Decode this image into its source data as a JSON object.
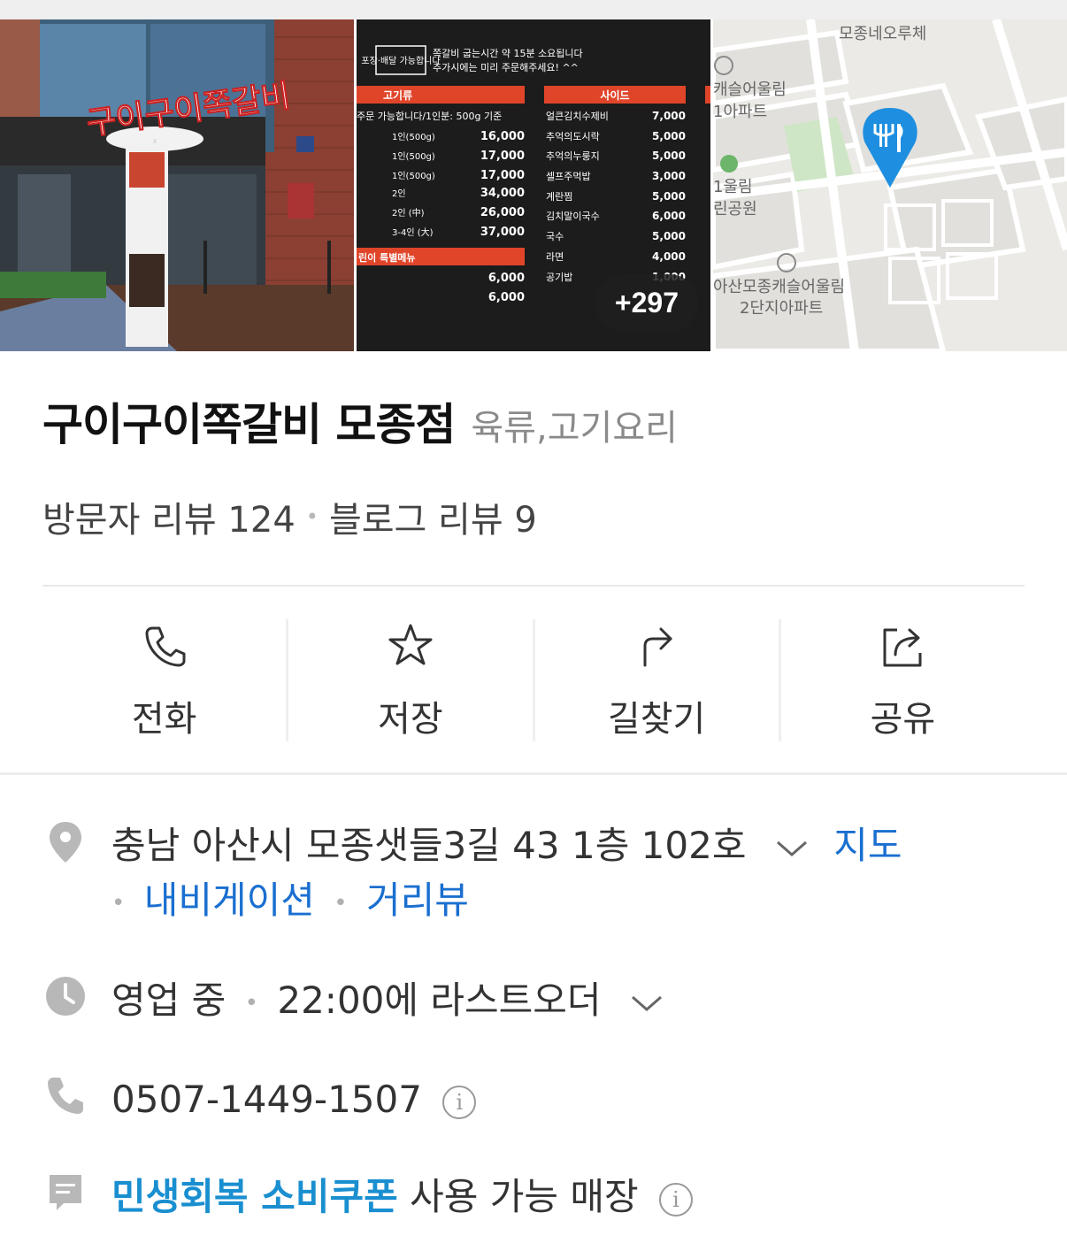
{
  "photos": {
    "more_count": "+297",
    "storefront": {
      "sign_text": "구이구이쪽갈비"
    },
    "menu": {
      "notice_badge": "포장·배달 가능합니다",
      "notice_line1": "쪽갈비 굽는시간 약 15분 소요됩니다",
      "notice_line2": "추가시에는 미리 주문해주세요! ^^",
      "meat_header": "고기류",
      "meat_note": "주문 가능합니다/1인분: 500g 기준",
      "meat_items": [
        {
          "name": "1인(500g)",
          "price": "16,000"
        },
        {
          "name": "1인(500g)",
          "price": "17,000"
        },
        {
          "name": "1인(500g)",
          "price": "17,000"
        },
        {
          "name": "2인",
          "price": "34,000"
        },
        {
          "name": "2인 (中)",
          "price": "26,000"
        },
        {
          "name": "3-4인 (大)",
          "price": "37,000"
        }
      ],
      "special_header": "린이 특별메뉴",
      "special_prices": [
        "6,000",
        "6,000"
      ],
      "side_header": "사이드",
      "side_items": [
        {
          "name": "얼큰김치수제비",
          "price": "7,000"
        },
        {
          "name": "추억의도시락",
          "price": "5,000"
        },
        {
          "name": "추억의누룽지",
          "price": "5,000"
        },
        {
          "name": "셀프주먹밥",
          "price": "3,000"
        },
        {
          "name": "계란찜",
          "price": "5,000"
        },
        {
          "name": "김치말이국수",
          "price": "6,000"
        },
        {
          "name": "국수",
          "price": "5,000"
        },
        {
          "name": "라면",
          "price": "4,000"
        },
        {
          "name": "공기밥",
          "price": "1,000"
        }
      ]
    },
    "map": {
      "label_top": "모종네오루체",
      "label_apt1_line1": "캐슬어울림",
      "label_apt1_line2": "1아파트",
      "label_park_line1": "1울림",
      "label_park_line2": "린공원",
      "label_apt2_line1": "아산모종캐슬어울림",
      "label_apt2_line2": "2단지아파트"
    }
  },
  "place": {
    "name": "구이구이쪽갈비 모종점",
    "category": "육류,고기요리",
    "visitor_reviews": "방문자 리뷰 124",
    "blog_reviews": "블로그 리뷰 9"
  },
  "actions": [
    {
      "label": "전화",
      "icon": "phone-icon"
    },
    {
      "label": "저장",
      "icon": "star-icon"
    },
    {
      "label": "길찾기",
      "icon": "directions-icon"
    },
    {
      "label": "공유",
      "icon": "share-icon"
    }
  ],
  "info": {
    "address": "충남 아산시 모종샛들3길 43 1층 102호",
    "map_link": "지도",
    "navigation_link": "내비게이션",
    "streetview_link": "거리뷰",
    "hours_status": "영업 중",
    "hours_detail": "22:00에 라스트오더",
    "phone": "0507-1449-1507",
    "coupon_highlight": "민생회복 소비쿠폰",
    "coupon_text": "사용 가능 매장"
  },
  "colors": {
    "link_blue": "#1a6fd0",
    "coupon_blue": "#1a8fd0",
    "map_pin": "#1e8fe0",
    "menu_red": "#e0452a"
  }
}
